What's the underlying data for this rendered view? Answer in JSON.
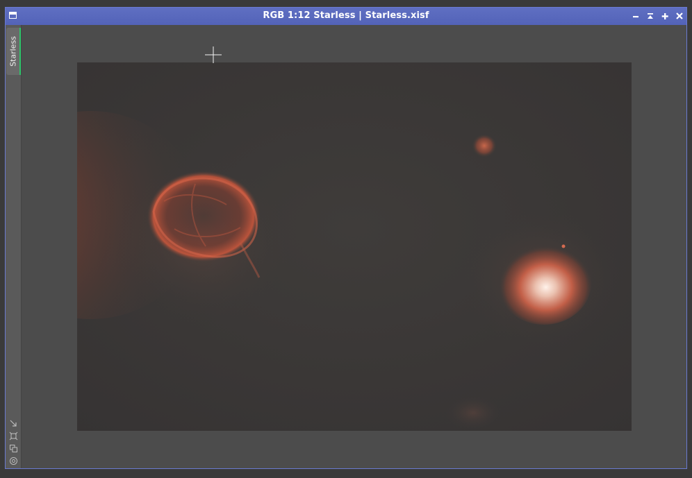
{
  "window": {
    "title": "RGB 1:12 Starless | Starless.xisf",
    "icon": "window-icon",
    "controls": [
      {
        "name": "minimize",
        "icon": "minimize-icon"
      },
      {
        "name": "shade",
        "icon": "shade-icon"
      },
      {
        "name": "maximize",
        "icon": "maximize-icon"
      },
      {
        "name": "close",
        "icon": "close-icon"
      }
    ]
  },
  "sidebar": {
    "tabs": [
      {
        "label": "Starless",
        "active": true
      }
    ],
    "tools": [
      {
        "icon": "resize-arrow-icon"
      },
      {
        "icon": "fit-view-icon"
      },
      {
        "icon": "clone-icon"
      },
      {
        "icon": "target-icon"
      }
    ]
  },
  "colors": {
    "titlebar": "#5866bb",
    "tab_accent": "#2fc46a",
    "background": "#4c4c4c"
  }
}
